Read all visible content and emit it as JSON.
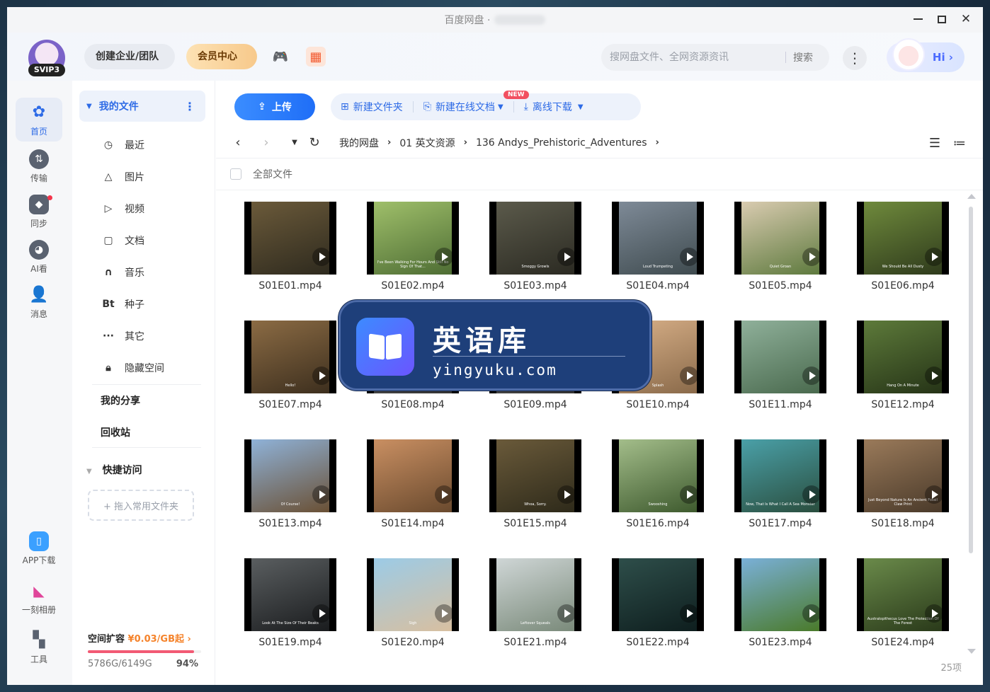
{
  "window": {
    "title": "百度网盘 ·"
  },
  "header": {
    "badge": "SVIP3",
    "team_btn": "创建企业/团队",
    "vip_btn": "会员中心",
    "search_placeholder": "搜网盘文件、全网资源资讯",
    "search_btn": "搜索",
    "hi": "Hi ›"
  },
  "rail": {
    "items": [
      {
        "label": "首页"
      },
      {
        "label": "传输"
      },
      {
        "label": "同步"
      },
      {
        "label": "AI看"
      },
      {
        "label": "消息"
      },
      {
        "label": "APP下载"
      },
      {
        "label": "一刻相册"
      },
      {
        "label": "工具"
      }
    ]
  },
  "sidebar": {
    "my_files": "我的文件",
    "items": [
      {
        "icon": "clock-icon",
        "label": "最近"
      },
      {
        "icon": "image-icon",
        "label": "图片"
      },
      {
        "icon": "play-icon",
        "label": "视频"
      },
      {
        "icon": "document-icon",
        "label": "文档"
      },
      {
        "icon": "headphones-icon",
        "label": "音乐"
      },
      {
        "icon": "bt-icon",
        "label": "种子",
        "glyph": "Bt"
      },
      {
        "icon": "dots-icon",
        "label": "其它",
        "glyph": "···"
      },
      {
        "icon": "lock-icon",
        "label": "隐藏空间"
      }
    ],
    "my_share": "我的分享",
    "recycle": "回收站",
    "quick_access": "快捷访问",
    "drop_hint": "+ 拖入常用文件夹",
    "storage": {
      "title": "空间扩容",
      "price": "¥0.03/GB起",
      "arrow": "›",
      "used": "5786G/6149G",
      "percent": "94%",
      "fraction": 0.94
    }
  },
  "toolbar": {
    "upload": "上传",
    "new_folder": "新建文件夹",
    "new_doc": "新建在线文档",
    "new_badge": "NEW",
    "offline": "离线下载"
  },
  "breadcrumb": {
    "items": [
      "我的网盘",
      "01 英文资源",
      "136 Andys_Prehistoric_Adventures"
    ]
  },
  "list": {
    "select_all": "全部文件",
    "count": "25项"
  },
  "files": [
    {
      "name": "S01E01.mp4",
      "cap": "",
      "c1": "#6b5a3a",
      "c2": "#2e2a1e"
    },
    {
      "name": "S01E02.mp4",
      "cap": "I've Been Walking For Hours And Still No Sign Of That...",
      "c1": "#9fbf6a",
      "c2": "#4e6d34"
    },
    {
      "name": "S01E03.mp4",
      "cap": "Smoggy Growls",
      "c1": "#5b5a4b",
      "c2": "#2b2a22"
    },
    {
      "name": "S01E04.mp4",
      "cap": "Loud Trumpeting",
      "c1": "#7e8a97",
      "c2": "#3f4b4f"
    },
    {
      "name": "S01E05.mp4",
      "cap": "Quiet Groan",
      "c1": "#d9cbb0",
      "c2": "#5e7a3e"
    },
    {
      "name": "S01E06.mp4",
      "cap": "We Should Be All Dusty",
      "c1": "#6f8a3c",
      "c2": "#2f3b1c"
    },
    {
      "name": "S01E07.mp4",
      "cap": "Hello!",
      "c1": "#8b6b44",
      "c2": "#3d2f1e"
    },
    {
      "name": "S01E08.mp4",
      "cap": "",
      "c1": "#666",
      "c2": "#333"
    },
    {
      "name": "S01E09.mp4",
      "cap": "",
      "c1": "#666",
      "c2": "#333"
    },
    {
      "name": "S01E10.mp4",
      "cap": "Splash",
      "c1": "#d8b088",
      "c2": "#8a6a4a"
    },
    {
      "name": "S01E11.mp4",
      "cap": "",
      "c1": "#8fb09a",
      "c2": "#4a6a4e"
    },
    {
      "name": "S01E12.mp4",
      "cap": "Hang On A Minute",
      "c1": "#5d7a3a",
      "c2": "#263417"
    },
    {
      "name": "S01E13.mp4",
      "cap": "Of Course!",
      "c1": "#8fb2d8",
      "c2": "#6a5034"
    },
    {
      "name": "S01E14.mp4",
      "cap": "",
      "c1": "#c98f62",
      "c2": "#6a4a2e"
    },
    {
      "name": "S01E15.mp4",
      "cap": "Whoa, Sorry.",
      "c1": "#6a5a3a",
      "c2": "#2e2a1a"
    },
    {
      "name": "S01E16.mp4",
      "cap": "Swooshing",
      "c1": "#a3bd8a",
      "c2": "#3e5a2e"
    },
    {
      "name": "S01E17.mp4",
      "cap": "Now, That Is What I Call A Sea Monster",
      "c1": "#4aa0a8",
      "c2": "#2a4e3e"
    },
    {
      "name": "S01E18.mp4",
      "cap": "Just Beyond Nature Is An Ancient Fossil Claw Print",
      "c1": "#9a7a5a",
      "c2": "#4a3a2a"
    },
    {
      "name": "S01E19.mp4",
      "cap": "Look At The Size Of Their Beaks",
      "c1": "#5a5e60",
      "c2": "#1a1c1e"
    },
    {
      "name": "S01E20.mp4",
      "cap": "Sigh",
      "c1": "#9ccbe6",
      "c2": "#d8bfa0"
    },
    {
      "name": "S01E21.mp4",
      "cap": "Leftover Squeals",
      "c1": "#cfd6d6",
      "c2": "#7a8a7a"
    },
    {
      "name": "S01E22.mp4",
      "cap": "",
      "c1": "#2e4e4a",
      "c2": "#0e1e1e"
    },
    {
      "name": "S01E23.mp4",
      "cap": "",
      "c1": "#7ab0d8",
      "c2": "#4a7a2a"
    },
    {
      "name": "S01E24.mp4",
      "cap": "Australopithecus Love The Protection Of The Forest",
      "c1": "#6a8a4a",
      "c2": "#2a3a1a"
    }
  ],
  "watermark": {
    "title": "英语库",
    "url": "yingyuku.com"
  }
}
